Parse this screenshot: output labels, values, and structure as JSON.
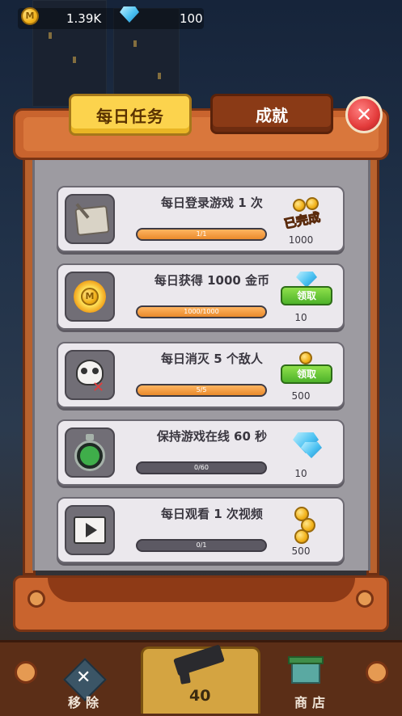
{
  "top_bar": {
    "coins": "1.39K",
    "gems": "100",
    "coin_icon": "coin-icon",
    "gem_icon": "gem-icon"
  },
  "tabs": [
    {
      "label": "每日任务",
      "active": true
    },
    {
      "label": "成就",
      "active": false
    }
  ],
  "tasks": [
    {
      "title": "每日登录游戏 1 次",
      "progress_text": "1/1",
      "progress": 1.0,
      "status": "已完成",
      "reward": "1000",
      "reward_type": "coin",
      "icon": "scroll-icon"
    },
    {
      "title": "每日获得 1000 金币",
      "progress_text": "1000/1000",
      "progress": 1.0,
      "status": "领取",
      "reward": "10",
      "reward_type": "gem",
      "icon": "sun-coin-icon"
    },
    {
      "title": "每日消灭 5 个敌人",
      "progress_text": "5/5",
      "progress": 1.0,
      "status": "领取",
      "reward": "500",
      "reward_type": "coin",
      "icon": "skull-icon"
    },
    {
      "title": "保持游戏在线 60 秒",
      "progress_text": "0/60",
      "progress": 0.0,
      "status": "",
      "reward": "10",
      "reward_type": "gem",
      "icon": "stopwatch-icon"
    },
    {
      "title": "每日观看 1 次视频",
      "progress_text": "0/1",
      "progress": 0.0,
      "status": "",
      "reward": "500",
      "reward_type": "coin",
      "icon": "video-icon"
    }
  ],
  "bottom_nav": {
    "remove_label": "移除",
    "gun_count": "40",
    "shop_label": "商店"
  },
  "colors": {
    "accent_yellow": "#fcd34d",
    "panel_orange": "#c9642e",
    "claim_green": "#4db22a",
    "progress_orange": "#e98a2c"
  }
}
